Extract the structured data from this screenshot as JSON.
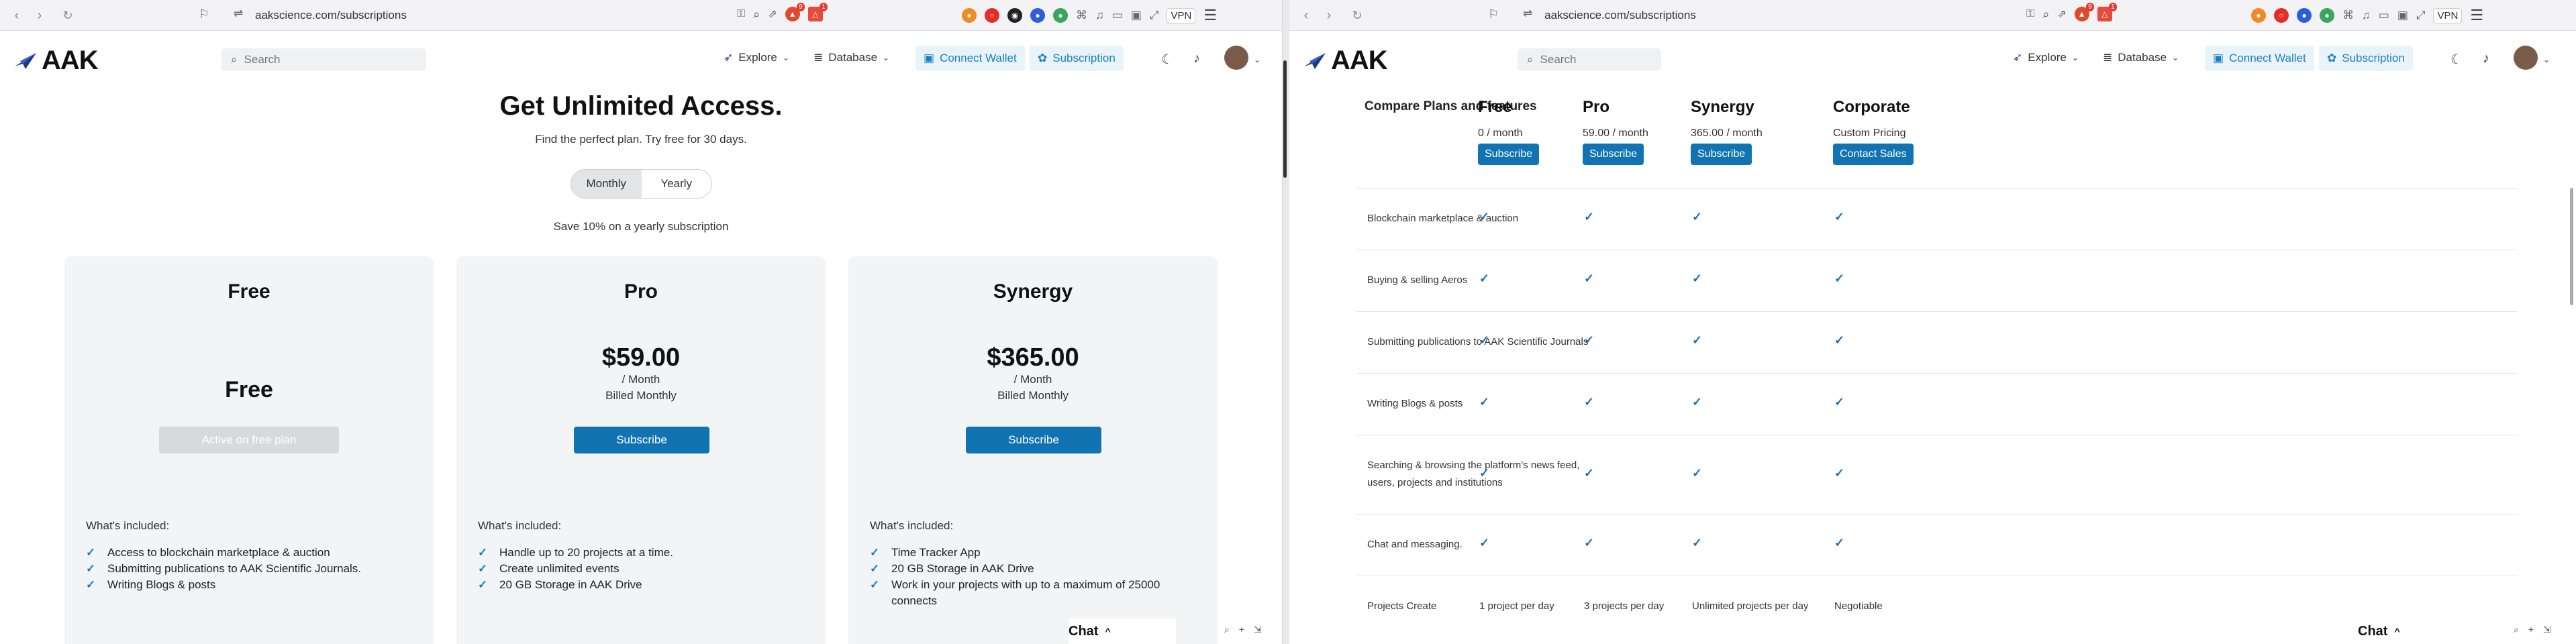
{
  "browser": {
    "url": "aakscience.com/subscriptions",
    "vpn_label": "VPN",
    "badge_counts": [
      "9",
      "1"
    ]
  },
  "site": {
    "logo": "AAK",
    "search_placeholder": "Search",
    "nav": {
      "explore": "Explore",
      "database": "Database",
      "connect_wallet": "Connect Wallet",
      "subscription": "Subscription"
    }
  },
  "hero": {
    "title": "Get Unlimited Access.",
    "subtitle": "Find the perfect plan. Try free for 30 days.",
    "toggle": [
      "Monthly",
      "Yearly"
    ],
    "save_note": "Save 10% on a yearly subscription"
  },
  "cards": [
    {
      "title": "Free",
      "price": "Free",
      "button": "Active on free plan",
      "included_label": "What's included:",
      "features": [
        "Access to blockchain marketplace & auction",
        "Submitting publications to AAK Scientific Journals.",
        "Writing Blogs & posts"
      ]
    },
    {
      "title": "Pro",
      "price": "$59.00",
      "period": "/ Month",
      "billing": "Billed Monthly",
      "button": "Subscribe",
      "included_label": "What's included:",
      "features": [
        "Handle up to 20 projects at a time.",
        "Create unlimited events",
        "20 GB Storage in AAK Drive"
      ]
    },
    {
      "title": "Synergy",
      "price": "$365.00",
      "period": "/ Month",
      "billing": "Billed Monthly",
      "button": "Subscribe",
      "included_label": "What's included:",
      "features": [
        "Time Tracker App",
        "20 GB Storage in AAK Drive",
        "Work in your projects with up to a maximum of 25000 connects"
      ]
    }
  ],
  "compare": {
    "heading": "Compare Plans and features",
    "plans": [
      {
        "name": "Free",
        "price": "0 / month",
        "button": "Subscribe"
      },
      {
        "name": "Pro",
        "price": "59.00 / month",
        "button": "Subscribe"
      },
      {
        "name": "Synergy",
        "price": "365.00 / month",
        "button": "Subscribe"
      },
      {
        "name": "Corporate",
        "price": "Custom Pricing",
        "button": "Contact Sales"
      }
    ],
    "rows": [
      {
        "label": "Blockchain marketplace & auction",
        "values": [
          "✓",
          "✓",
          "✓",
          "✓"
        ]
      },
      {
        "label": "Buying & selling Aeros",
        "values": [
          "✓",
          "✓",
          "✓",
          "✓"
        ]
      },
      {
        "label": "Submitting publications to AAK Scientific Journals",
        "values": [
          "✓",
          "✓",
          "✓",
          "✓"
        ]
      },
      {
        "label": "Writing Blogs & posts",
        "values": [
          "✓",
          "✓",
          "✓",
          "✓"
        ]
      },
      {
        "label": "Searching & browsing the platform's news feed, users, projects and institutions",
        "values": [
          "✓",
          "✓",
          "✓",
          "✓"
        ]
      },
      {
        "label": "Chat and messaging.",
        "values": [
          "✓",
          "✓",
          "✓",
          "✓"
        ]
      },
      {
        "label": "Projects Create",
        "values": [
          "1 project per day",
          "3 projects per day",
          "Unlimited projects per day",
          "Negotiable"
        ]
      }
    ]
  },
  "chat": {
    "label": "Chat"
  },
  "colors": {
    "accent": "#1273b3",
    "card_bg": "#f3f4f6",
    "check": "#1a7fc1"
  }
}
